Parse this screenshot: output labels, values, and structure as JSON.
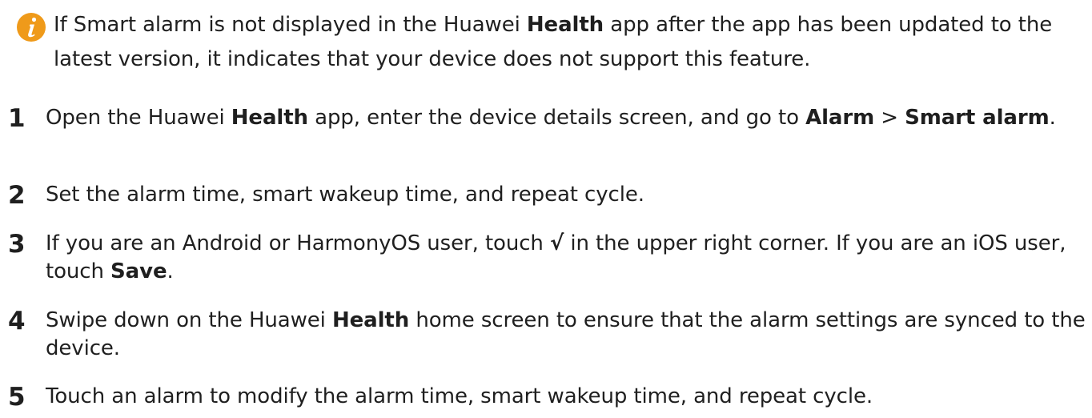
{
  "note": {
    "icon": "info-icon",
    "icon_color": "#ef9a1a",
    "t1": "If Smart alarm is not displayed in the Huawei ",
    "b1": "Health",
    "t2": " app after the app has been updated to the latest version, it indicates that your device does not support this feature."
  },
  "steps": [
    {
      "num": "1",
      "t1": "Open the Huawei ",
      "b1": "Health",
      "t2": " app, enter the device details screen, and go to ",
      "b2": "Alarm",
      "t3": " > ",
      "b3": "Smart alarm",
      "t4": "."
    },
    {
      "num": "2",
      "t1": "Set the alarm time, smart wakeup time, and repeat cycle."
    },
    {
      "num": "3",
      "t1": "If you are an Android or HarmonyOS user, touch ",
      "b1": "√",
      "t2": " in the upper right corner. If you are an iOS user, touch ",
      "b2": "Save",
      "t3": "."
    },
    {
      "num": "4",
      "t1": "Swipe down on the Huawei ",
      "b1": "Health",
      "t2": " home screen to ensure that the alarm settings are synced to the device."
    },
    {
      "num": "5",
      "t1": "Touch an alarm to modify the alarm time, smart wakeup time, and repeat cycle."
    }
  ]
}
